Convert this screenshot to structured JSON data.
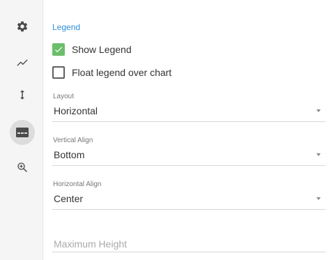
{
  "sidebar": {
    "items": [
      {
        "id": "settings",
        "icon": "gear-icon",
        "active": false
      },
      {
        "id": "series",
        "icon": "trend-line-icon",
        "active": false
      },
      {
        "id": "axis",
        "icon": "vertical-arrows-icon",
        "active": false
      },
      {
        "id": "legend",
        "icon": "legend-icon",
        "active": true
      },
      {
        "id": "zoom",
        "icon": "zoom-in-icon",
        "active": false
      }
    ]
  },
  "legend_panel": {
    "title": "Legend",
    "show_legend": {
      "label": "Show Legend",
      "checked": true
    },
    "float_legend": {
      "label": "Float legend over chart",
      "checked": false
    },
    "layout": {
      "label": "Layout",
      "value": "Horizontal"
    },
    "vertical_align": {
      "label": "Vertical Align",
      "value": "Bottom"
    },
    "horizontal_align": {
      "label": "Horizontal Align",
      "value": "Center"
    },
    "max_height": {
      "placeholder": "Maximum Height",
      "value": ""
    }
  },
  "colors": {
    "accent": "#2f8fe0",
    "checkbox_checked": "#6bbf6a"
  }
}
